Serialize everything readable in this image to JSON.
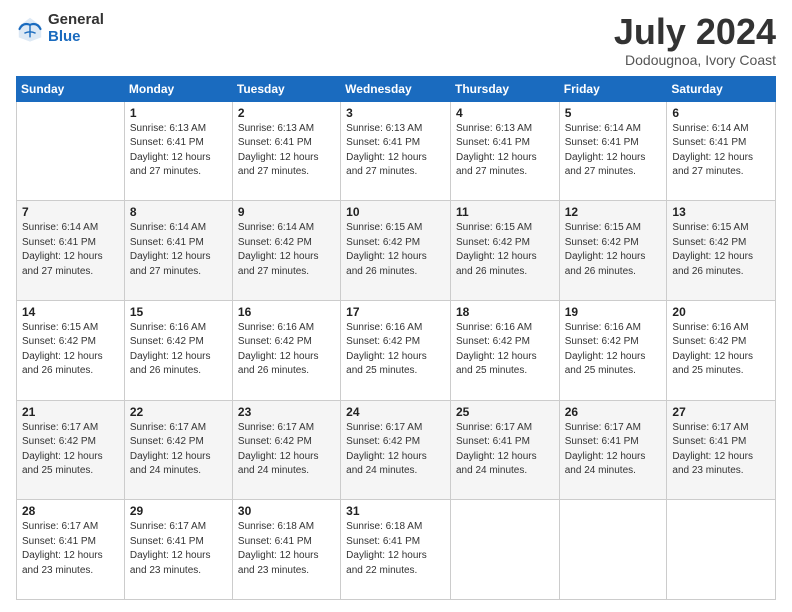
{
  "header": {
    "logo_general": "General",
    "logo_blue": "Blue",
    "month_year": "July 2024",
    "location": "Dodougnoa, Ivory Coast"
  },
  "days_of_week": [
    "Sunday",
    "Monday",
    "Tuesday",
    "Wednesday",
    "Thursday",
    "Friday",
    "Saturday"
  ],
  "weeks": [
    [
      {
        "day": "",
        "info": ""
      },
      {
        "day": "1",
        "info": "Sunrise: 6:13 AM\nSunset: 6:41 PM\nDaylight: 12 hours\nand 27 minutes."
      },
      {
        "day": "2",
        "info": "Sunrise: 6:13 AM\nSunset: 6:41 PM\nDaylight: 12 hours\nand 27 minutes."
      },
      {
        "day": "3",
        "info": "Sunrise: 6:13 AM\nSunset: 6:41 PM\nDaylight: 12 hours\nand 27 minutes."
      },
      {
        "day": "4",
        "info": "Sunrise: 6:13 AM\nSunset: 6:41 PM\nDaylight: 12 hours\nand 27 minutes."
      },
      {
        "day": "5",
        "info": "Sunrise: 6:14 AM\nSunset: 6:41 PM\nDaylight: 12 hours\nand 27 minutes."
      },
      {
        "day": "6",
        "info": "Sunrise: 6:14 AM\nSunset: 6:41 PM\nDaylight: 12 hours\nand 27 minutes."
      }
    ],
    [
      {
        "day": "7",
        "info": "Sunrise: 6:14 AM\nSunset: 6:41 PM\nDaylight: 12 hours\nand 27 minutes."
      },
      {
        "day": "8",
        "info": "Sunrise: 6:14 AM\nSunset: 6:41 PM\nDaylight: 12 hours\nand 27 minutes."
      },
      {
        "day": "9",
        "info": "Sunrise: 6:14 AM\nSunset: 6:42 PM\nDaylight: 12 hours\nand 27 minutes."
      },
      {
        "day": "10",
        "info": "Sunrise: 6:15 AM\nSunset: 6:42 PM\nDaylight: 12 hours\nand 26 minutes."
      },
      {
        "day": "11",
        "info": "Sunrise: 6:15 AM\nSunset: 6:42 PM\nDaylight: 12 hours\nand 26 minutes."
      },
      {
        "day": "12",
        "info": "Sunrise: 6:15 AM\nSunset: 6:42 PM\nDaylight: 12 hours\nand 26 minutes."
      },
      {
        "day": "13",
        "info": "Sunrise: 6:15 AM\nSunset: 6:42 PM\nDaylight: 12 hours\nand 26 minutes."
      }
    ],
    [
      {
        "day": "14",
        "info": "Sunrise: 6:15 AM\nSunset: 6:42 PM\nDaylight: 12 hours\nand 26 minutes."
      },
      {
        "day": "15",
        "info": "Sunrise: 6:16 AM\nSunset: 6:42 PM\nDaylight: 12 hours\nand 26 minutes."
      },
      {
        "day": "16",
        "info": "Sunrise: 6:16 AM\nSunset: 6:42 PM\nDaylight: 12 hours\nand 26 minutes."
      },
      {
        "day": "17",
        "info": "Sunrise: 6:16 AM\nSunset: 6:42 PM\nDaylight: 12 hours\nand 25 minutes."
      },
      {
        "day": "18",
        "info": "Sunrise: 6:16 AM\nSunset: 6:42 PM\nDaylight: 12 hours\nand 25 minutes."
      },
      {
        "day": "19",
        "info": "Sunrise: 6:16 AM\nSunset: 6:42 PM\nDaylight: 12 hours\nand 25 minutes."
      },
      {
        "day": "20",
        "info": "Sunrise: 6:16 AM\nSunset: 6:42 PM\nDaylight: 12 hours\nand 25 minutes."
      }
    ],
    [
      {
        "day": "21",
        "info": "Sunrise: 6:17 AM\nSunset: 6:42 PM\nDaylight: 12 hours\nand 25 minutes."
      },
      {
        "day": "22",
        "info": "Sunrise: 6:17 AM\nSunset: 6:42 PM\nDaylight: 12 hours\nand 24 minutes."
      },
      {
        "day": "23",
        "info": "Sunrise: 6:17 AM\nSunset: 6:42 PM\nDaylight: 12 hours\nand 24 minutes."
      },
      {
        "day": "24",
        "info": "Sunrise: 6:17 AM\nSunset: 6:42 PM\nDaylight: 12 hours\nand 24 minutes."
      },
      {
        "day": "25",
        "info": "Sunrise: 6:17 AM\nSunset: 6:41 PM\nDaylight: 12 hours\nand 24 minutes."
      },
      {
        "day": "26",
        "info": "Sunrise: 6:17 AM\nSunset: 6:41 PM\nDaylight: 12 hours\nand 24 minutes."
      },
      {
        "day": "27",
        "info": "Sunrise: 6:17 AM\nSunset: 6:41 PM\nDaylight: 12 hours\nand 23 minutes."
      }
    ],
    [
      {
        "day": "28",
        "info": "Sunrise: 6:17 AM\nSunset: 6:41 PM\nDaylight: 12 hours\nand 23 minutes."
      },
      {
        "day": "29",
        "info": "Sunrise: 6:17 AM\nSunset: 6:41 PM\nDaylight: 12 hours\nand 23 minutes."
      },
      {
        "day": "30",
        "info": "Sunrise: 6:18 AM\nSunset: 6:41 PM\nDaylight: 12 hours\nand 23 minutes."
      },
      {
        "day": "31",
        "info": "Sunrise: 6:18 AM\nSunset: 6:41 PM\nDaylight: 12 hours\nand 22 minutes."
      },
      {
        "day": "",
        "info": ""
      },
      {
        "day": "",
        "info": ""
      },
      {
        "day": "",
        "info": ""
      }
    ]
  ]
}
